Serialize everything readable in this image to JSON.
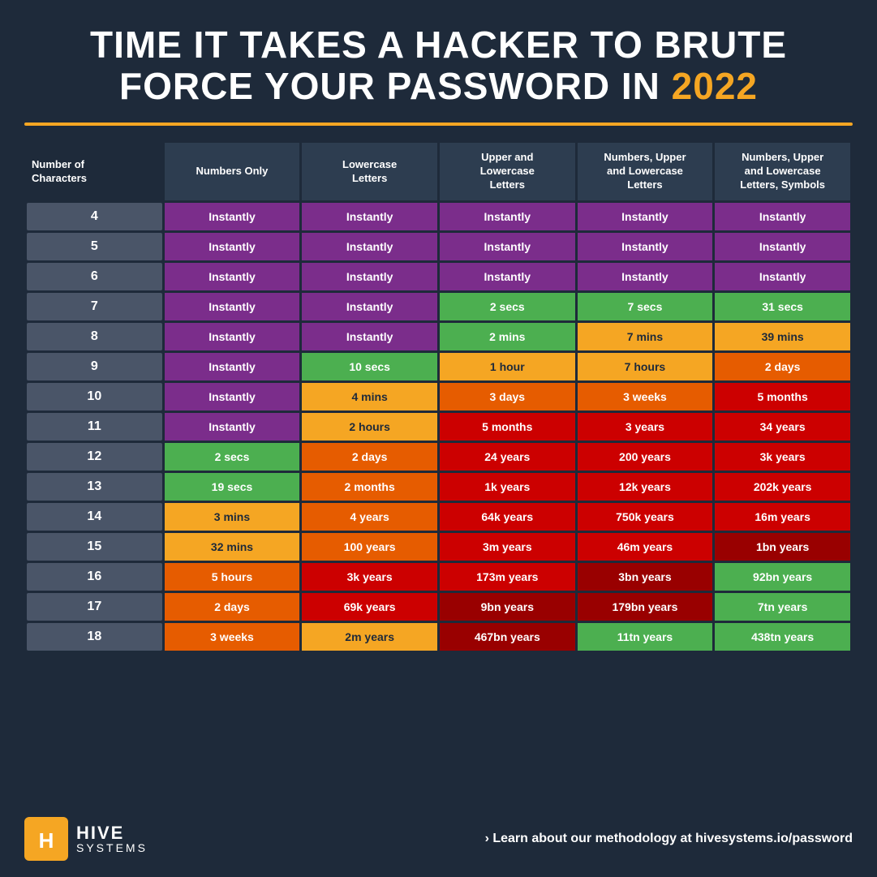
{
  "title": {
    "line1": "TIME IT TAKES A HACKER TO BRUTE",
    "line2": "FORCE YOUR PASSWORD IN ",
    "year": "2022"
  },
  "columns": [
    "Number of\nCharacters",
    "Numbers Only",
    "Lowercase\nLetters",
    "Upper and\nLowercase\nLetters",
    "Numbers, Upper\nand Lowercase\nLetters",
    "Numbers, Upper\nand Lowercase\nLetters, Symbols"
  ],
  "rows": [
    {
      "chars": "4",
      "data": [
        "Instantly",
        "Instantly",
        "Instantly",
        "Instantly",
        "Instantly"
      ],
      "colors": [
        "purple",
        "purple",
        "purple",
        "purple",
        "purple"
      ]
    },
    {
      "chars": "5",
      "data": [
        "Instantly",
        "Instantly",
        "Instantly",
        "Instantly",
        "Instantly"
      ],
      "colors": [
        "purple",
        "purple",
        "purple",
        "purple",
        "purple"
      ]
    },
    {
      "chars": "6",
      "data": [
        "Instantly",
        "Instantly",
        "Instantly",
        "Instantly",
        "Instantly"
      ],
      "colors": [
        "purple",
        "purple",
        "purple",
        "purple",
        "purple"
      ]
    },
    {
      "chars": "7",
      "data": [
        "Instantly",
        "Instantly",
        "2 secs",
        "7 secs",
        "31 secs"
      ],
      "colors": [
        "purple",
        "purple",
        "green",
        "green",
        "green"
      ]
    },
    {
      "chars": "8",
      "data": [
        "Instantly",
        "Instantly",
        "2 mins",
        "7 mins",
        "39 mins"
      ],
      "colors": [
        "purple",
        "purple",
        "green",
        "yellow",
        "yellow"
      ]
    },
    {
      "chars": "9",
      "data": [
        "Instantly",
        "10 secs",
        "1 hour",
        "7 hours",
        "2 days"
      ],
      "colors": [
        "purple",
        "green",
        "yellow",
        "yellow",
        "orange"
      ]
    },
    {
      "chars": "10",
      "data": [
        "Instantly",
        "4 mins",
        "3 days",
        "3 weeks",
        "5 months"
      ],
      "colors": [
        "purple",
        "yellow",
        "orange",
        "orange",
        "red"
      ]
    },
    {
      "chars": "11",
      "data": [
        "Instantly",
        "2 hours",
        "5 months",
        "3 years",
        "34 years"
      ],
      "colors": [
        "purple",
        "yellow",
        "red",
        "red",
        "red"
      ]
    },
    {
      "chars": "12",
      "data": [
        "2 secs",
        "2 days",
        "24 years",
        "200 years",
        "3k years"
      ],
      "colors": [
        "green",
        "orange",
        "red",
        "red",
        "red"
      ]
    },
    {
      "chars": "13",
      "data": [
        "19 secs",
        "2 months",
        "1k years",
        "12k years",
        "202k years"
      ],
      "colors": [
        "green",
        "orange",
        "red",
        "red",
        "red"
      ]
    },
    {
      "chars": "14",
      "data": [
        "3 mins",
        "4 years",
        "64k years",
        "750k years",
        "16m years"
      ],
      "colors": [
        "yellow",
        "orange",
        "red",
        "red",
        "red"
      ]
    },
    {
      "chars": "15",
      "data": [
        "32 mins",
        "100 years",
        "3m years",
        "46m years",
        "1bn years"
      ],
      "colors": [
        "yellow",
        "orange",
        "red",
        "red",
        "dark-red"
      ]
    },
    {
      "chars": "16",
      "data": [
        "5 hours",
        "3k years",
        "173m years",
        "3bn years",
        "92bn years"
      ],
      "colors": [
        "orange",
        "red",
        "red",
        "dark-red",
        "green"
      ]
    },
    {
      "chars": "17",
      "data": [
        "2 days",
        "69k years",
        "9bn years",
        "179bn years",
        "7tn years"
      ],
      "colors": [
        "orange",
        "red",
        "dark-red",
        "dark-red",
        "green"
      ]
    },
    {
      "chars": "18",
      "data": [
        "3 weeks",
        "2m years",
        "467bn years",
        "11tn years",
        "438tn years"
      ],
      "colors": [
        "orange",
        "yellow",
        "dark-red",
        "green",
        "green"
      ]
    }
  ],
  "footer": {
    "logo_hive": "HIVE",
    "logo_systems": "SYSTEMS",
    "link_prefix": "› Learn about our methodology at ",
    "link_url": "hivesystems.io/password"
  }
}
